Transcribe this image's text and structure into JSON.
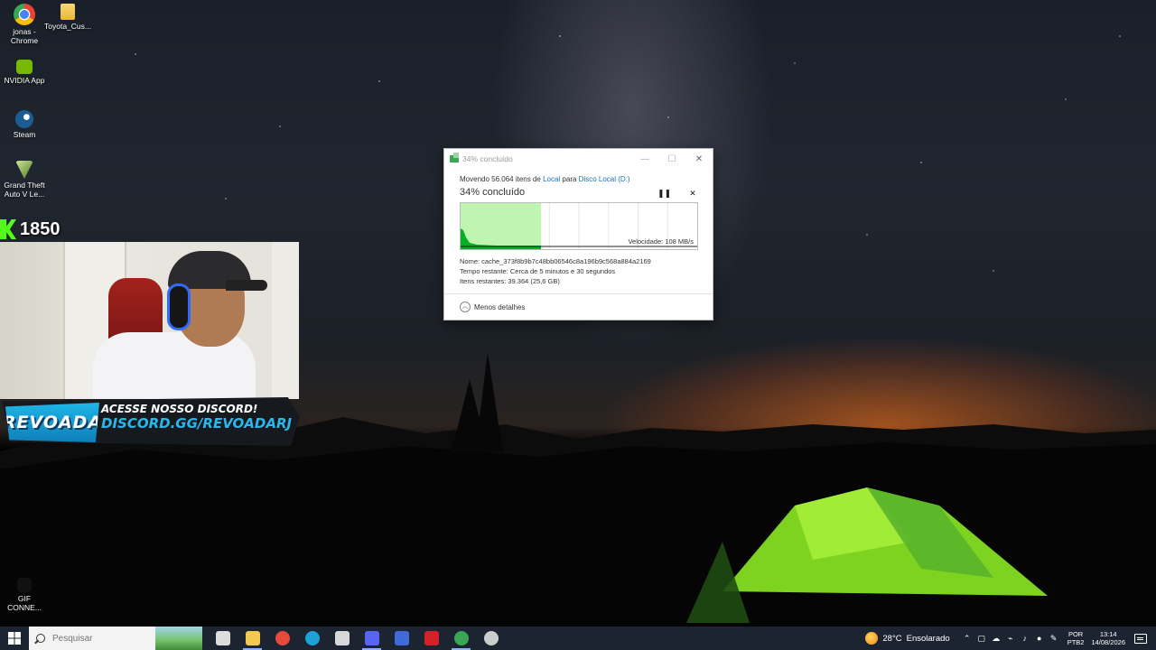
{
  "desktop": {
    "icons": [
      {
        "label": "jonas - Chrome",
        "icon": "chrome-icon",
        "color": "#e64a3b"
      },
      {
        "label": "Toyota_Cus...",
        "icon": "folder-icon",
        "color": "#f0c33c"
      },
      {
        "label": "NVIDIA App",
        "icon": "nvidia-icon",
        "color": "#76b900"
      },
      {
        "label": "Steam",
        "icon": "steam-icon",
        "color": "#1b5c93"
      },
      {
        "label": "Grand Theft Auto V Le...",
        "icon": "gta-icon",
        "color": "#7aa33a"
      },
      {
        "label": "GIF CONNE...",
        "icon": "gif-icon",
        "color": "#222222"
      }
    ]
  },
  "stream_overlay": {
    "kick_count": "1850",
    "banner_logo": "REVOADA",
    "banner_line1": "ACESSE NOSSO DISCORD!",
    "banner_line2": "DISCORD.GG/REVOADARJ"
  },
  "dialog": {
    "title": "34% concluído",
    "line_prefix": "Movendo 56.064 itens de ",
    "source": "Local",
    "line_mid": " para ",
    "destination": "Disco Local (D:)",
    "percent_label": "34% concluído",
    "pause_icon": "pause-icon",
    "cancel_icon": "close-icon",
    "speed": "Velocidade: 108 MB/s",
    "name": "Nome:  cache_373f8b9b7c48bb06546c8a196b9c568a884a2169",
    "time_remaining": "Tempo restante:  Cerca de 5 minutos e 30 segundos",
    "items_remaining": "Itens restantes:  39.364 (25,6 GB)",
    "less_details": "Menos detalhes",
    "progress": 0.34,
    "accent": "#06b025"
  },
  "taskbar": {
    "search_placeholder": "Pesquisar",
    "apps": [
      {
        "icon": "task-view-icon",
        "color": "#dddddd"
      },
      {
        "icon": "file-explorer-icon",
        "color": "#f2c94c",
        "active": true
      },
      {
        "icon": "chrome-icon",
        "color": "#e64a3b"
      },
      {
        "icon": "edge-icon",
        "color": "#1fa0d6"
      },
      {
        "icon": "store-icon",
        "color": "#d8d8d8"
      },
      {
        "icon": "discord-icon",
        "color": "#5865f2",
        "active": true
      },
      {
        "icon": "obs-app-icon",
        "color": "#3f6ad8"
      },
      {
        "icon": "acrobat-icon",
        "color": "#d62027"
      },
      {
        "icon": "chrome-profile-icon",
        "color": "#3aa757",
        "active": true
      },
      {
        "icon": "obs-icon",
        "color": "#cccccc"
      }
    ],
    "weather_temp": "28°C",
    "weather_text": "Ensolarado",
    "lang_line1": "POR",
    "lang_line2": "PTB2",
    "time": "13:14",
    "date": "14/08/2026"
  }
}
